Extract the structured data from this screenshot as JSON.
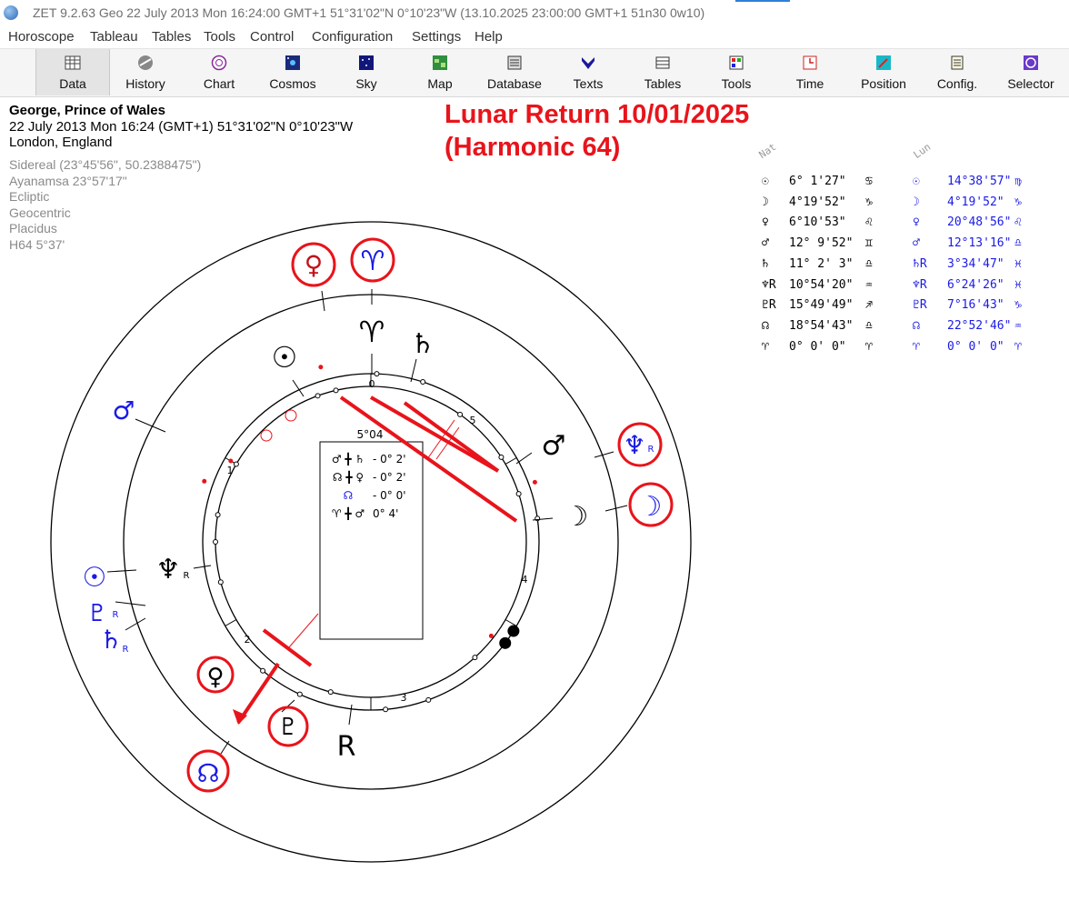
{
  "window": {
    "title": "ZET 9.2.63 Geo   22 July 2013  Mon  16:24:00 GMT+1 51°31'02\"N  0°10'23\"W  (13.10.2025  23:00:00 GMT+1 51n30 0w10)"
  },
  "menu": [
    "Horoscope",
    "Tableau",
    "Tables",
    "Tools",
    "Control",
    "Configuration",
    "Settings",
    "Help"
  ],
  "toolbar": [
    {
      "label": "Data",
      "icon": "data-icon",
      "active": true
    },
    {
      "label": "History",
      "icon": "history-icon"
    },
    {
      "label": "Chart",
      "icon": "chart-icon"
    },
    {
      "label": "Cosmos",
      "icon": "cosmos-icon"
    },
    {
      "label": "Sky",
      "icon": "sky-icon"
    },
    {
      "label": "Map",
      "icon": "map-icon"
    },
    {
      "label": "Database",
      "icon": "database-icon"
    },
    {
      "label": "Texts",
      "icon": "texts-icon"
    },
    {
      "label": "Tables",
      "icon": "tables-icon"
    },
    {
      "label": "Tools",
      "icon": "tools-icon"
    },
    {
      "label": "Time",
      "icon": "time-icon"
    },
    {
      "label": "Position",
      "icon": "position-icon"
    },
    {
      "label": "Config.",
      "icon": "config-icon"
    },
    {
      "label": "Selector",
      "icon": "selector-icon"
    }
  ],
  "chart_info": {
    "name": "George, Prince of Wales",
    "date_line": "22 July 2013  Mon  16:24 (GMT+1) 51°31'02\"N  0°10'23\"W",
    "place": "London, England",
    "settings": [
      "Sidereal (23°45'56\", 50.2388475\")",
      "Ayanamsa 23°57'17\"",
      "Ecliptic",
      "Geocentric",
      "Placidus",
      "H64   5°37'"
    ]
  },
  "overlay": {
    "line1": "Lunar Return 10/01/2025",
    "line2": "(Harmonic 64)"
  },
  "positions": {
    "header_nat": "Nat",
    "header_lun": "Lun",
    "rows": [
      {
        "glyph": "☉",
        "nat": "6° 1'27\"",
        "nat_sign": "♋",
        "lglyph": "☉",
        "lun": "14°38'57\"",
        "lun_sign": "♍"
      },
      {
        "glyph": "☽",
        "nat": "4°19'52\"",
        "nat_sign": "♑",
        "lglyph": "☽",
        "lun": "4°19'52\"",
        "lun_sign": "♑"
      },
      {
        "glyph": "♀",
        "nat": "6°10'53\"",
        "nat_sign": "♌",
        "lglyph": "♀",
        "lun": "20°48'56\"",
        "lun_sign": "♌"
      },
      {
        "glyph": "♂",
        "nat": "12° 9'52\"",
        "nat_sign": "♊",
        "lglyph": "♂",
        "lun": "12°13'16\"",
        "lun_sign": "♎"
      },
      {
        "glyph": "♄",
        "nat": "11° 2' 3\"",
        "nat_sign": "♎",
        "lglyph": "♄R",
        "lun": "3°34'47\"",
        "lun_sign": "♓"
      },
      {
        "glyph": "♆R",
        "nat": "10°54'20\"",
        "nat_sign": "♒",
        "lglyph": "♆R",
        "lun": "6°24'26\"",
        "lun_sign": "♓"
      },
      {
        "glyph": "♇R",
        "nat": "15°49'49\"",
        "nat_sign": "♐",
        "lglyph": "♇R",
        "lun": "7°16'43\"",
        "lun_sign": "♑"
      },
      {
        "glyph": "☊",
        "nat": "18°54'43\"",
        "nat_sign": "♎",
        "lglyph": "☊",
        "lun": "22°52'46\"",
        "lun_sign": "♒"
      },
      {
        "glyph": "♈",
        "nat": "0° 0' 0\"",
        "nat_sign": "♈",
        "lglyph": "♈",
        "lun": "0° 0' 0\"",
        "lun_sign": "♈"
      }
    ]
  },
  "wheel": {
    "center_label": "5°04",
    "aspects": [
      {
        "glyph": "♂ ╋ ♄",
        "value": "- 0° 2'"
      },
      {
        "glyph": "☊ ╋ ♀",
        "value": "- 0° 2'"
      },
      {
        "glyph": "☊",
        "value": "- 0° 0'"
      },
      {
        "glyph": "♈ ╋ ♂",
        "value": "0° 4'"
      }
    ],
    "house_numbers": [
      "0",
      "1",
      "2",
      "3",
      "4",
      "5"
    ],
    "outer_glyphs": [
      "♀",
      "♈",
      "♆",
      "R",
      "☽",
      "♂",
      "☉",
      "♇",
      "R",
      "♄",
      "R",
      "☊"
    ],
    "inner_glyphs": [
      "☉",
      "♈",
      "♄",
      "♂",
      "☽",
      "♆",
      "R",
      "♀",
      "♇",
      "R"
    ]
  }
}
